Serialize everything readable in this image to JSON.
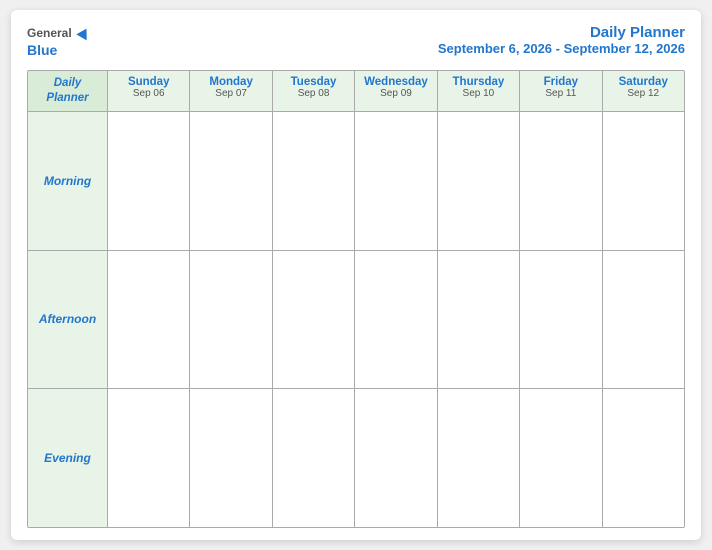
{
  "logo": {
    "general": "General",
    "blue": "Blue"
  },
  "title": {
    "main": "Daily Planner",
    "sub": "September 6, 2026 - September 12, 2026"
  },
  "columns": [
    {
      "label": "Daily\nPlanner",
      "date": ""
    },
    {
      "label": "Sunday",
      "date": "Sep 06"
    },
    {
      "label": "Monday",
      "date": "Sep 07"
    },
    {
      "label": "Tuesday",
      "date": "Sep 08"
    },
    {
      "label": "Wednesday",
      "date": "Sep 09"
    },
    {
      "label": "Thursday",
      "date": "Sep 10"
    },
    {
      "label": "Friday",
      "date": "Sep 11"
    },
    {
      "label": "Saturday",
      "date": "Sep 12"
    }
  ],
  "rows": [
    {
      "label": "Morning"
    },
    {
      "label": "Afternoon"
    },
    {
      "label": "Evening"
    }
  ]
}
